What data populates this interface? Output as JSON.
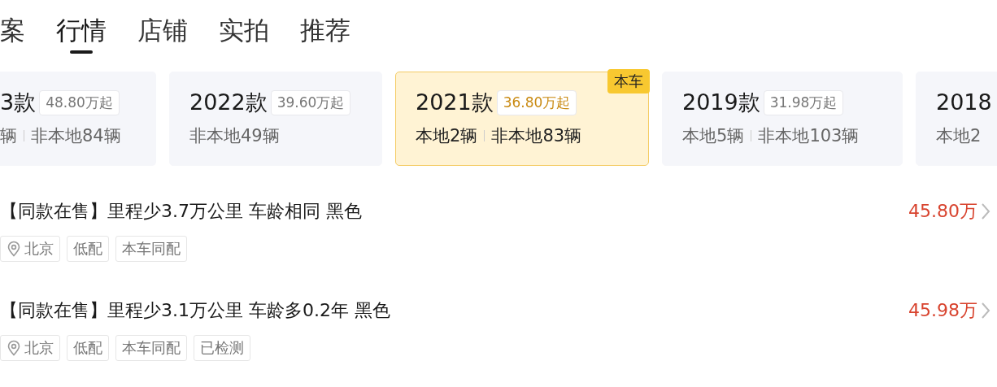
{
  "tabs": [
    {
      "label": "案",
      "selected": false
    },
    {
      "label": "行情",
      "selected": true
    },
    {
      "label": "店铺",
      "selected": false
    },
    {
      "label": "实拍",
      "selected": false
    },
    {
      "label": "推荐",
      "selected": false
    }
  ],
  "model_years": [
    {
      "year": "3款",
      "price": "48.80万起",
      "local": "辆",
      "nonlocal": "非本地84辆",
      "selected": false
    },
    {
      "year": "2022款",
      "price": "39.60万起",
      "nonlocal": "非本地49辆",
      "selected": false
    },
    {
      "year": "2021款",
      "price": "36.80万起",
      "local": "本地2辆",
      "nonlocal": "非本地83辆",
      "selected": true,
      "badge": "本车"
    },
    {
      "year": "2019款",
      "price": "31.98万起",
      "local": "本地5辆",
      "nonlocal": "非本地103辆",
      "selected": false
    },
    {
      "year": "2018",
      "local": "本地2",
      "selected": false
    }
  ],
  "listings": [
    {
      "title": "【同款在售】里程少3.7万公里 车龄相同 黑色",
      "price": "45.80万",
      "tags": [
        {
          "kind": "location",
          "text": "北京"
        },
        {
          "kind": "plain",
          "text": "低配"
        },
        {
          "kind": "plain",
          "text": "本车同配"
        }
      ]
    },
    {
      "title": "【同款在售】里程少3.1万公里 车龄多0.2年 黑色",
      "price": "45.98万",
      "tags": [
        {
          "kind": "location",
          "text": "北京"
        },
        {
          "kind": "plain",
          "text": "低配"
        },
        {
          "kind": "plain",
          "text": "本车同配"
        },
        {
          "kind": "plain",
          "text": "已检测"
        }
      ]
    }
  ]
}
